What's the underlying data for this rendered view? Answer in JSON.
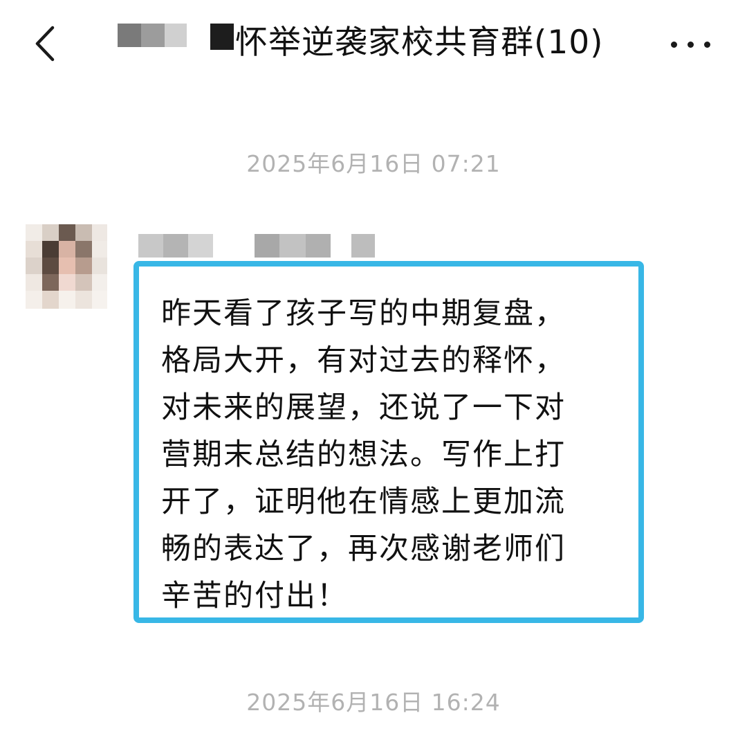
{
  "header": {
    "title": "怀举逆袭家校共育群(10)",
    "back_icon": "chevron-left-icon",
    "more_icon": "more-horizontal-icon"
  },
  "messages": [
    {
      "timestamp": "2025年6月16日 07:21",
      "text_lines": [
        "昨天看了孩子写的中期复盘，",
        "格局大开，有对过去的释怀，",
        "对未来的展望，还说了一下对",
        "营期末总结的想法。写作上打",
        "开了，证明他在情感上更加流",
        "畅的表达了，再次感谢老师们",
        "辛苦的付出！"
      ],
      "highlight_color": "#38b7e6"
    }
  ],
  "footer_timestamp": "2025年6月16日 16:24"
}
